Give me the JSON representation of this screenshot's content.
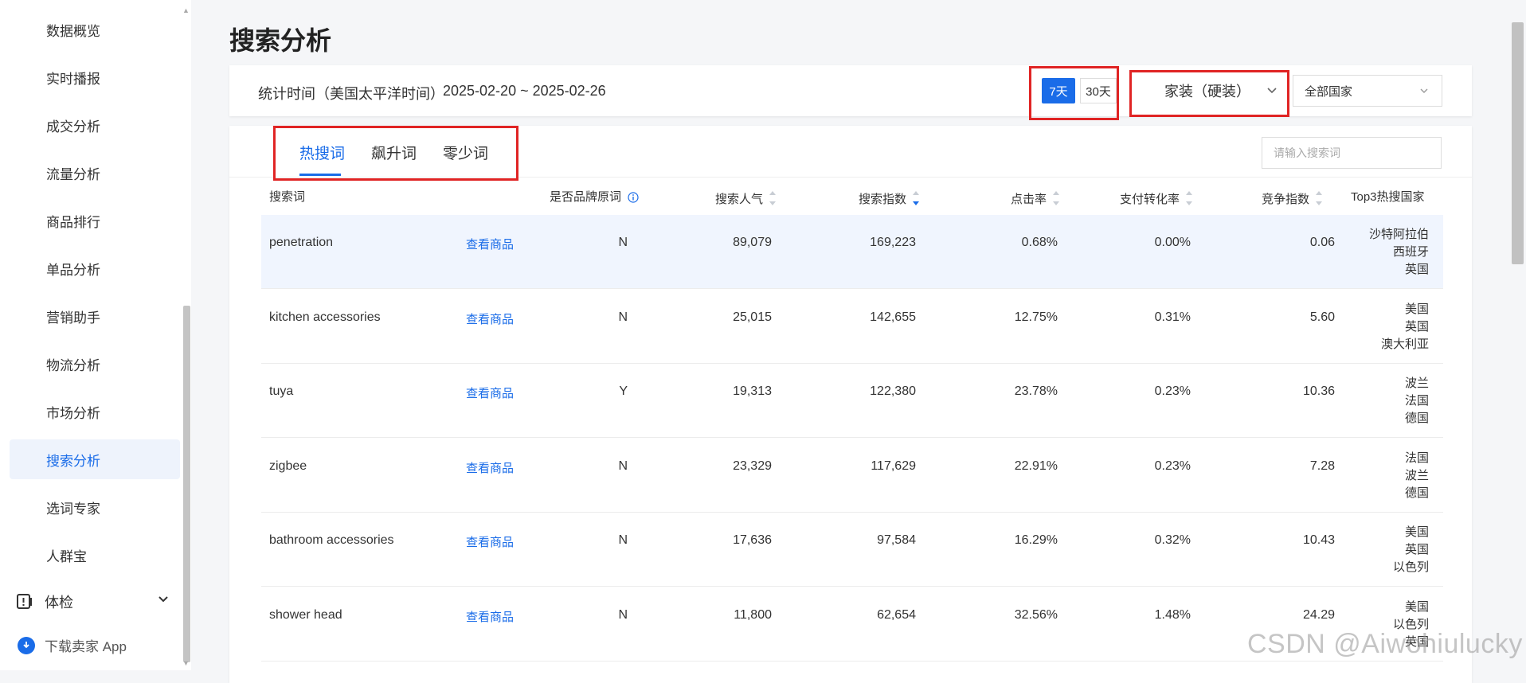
{
  "sidebar": {
    "items": [
      {
        "label": "数据概览",
        "active": false
      },
      {
        "label": "实时播报",
        "active": false
      },
      {
        "label": "成交分析",
        "active": false
      },
      {
        "label": "流量分析",
        "active": false
      },
      {
        "label": "商品排行",
        "active": false
      },
      {
        "label": "单品分析",
        "active": false
      },
      {
        "label": "营销助手",
        "active": false
      },
      {
        "label": "物流分析",
        "active": false
      },
      {
        "label": "市场分析",
        "active": false
      },
      {
        "label": "搜索分析",
        "active": true
      },
      {
        "label": "选词专家",
        "active": false
      },
      {
        "label": "人群宝",
        "active": false
      }
    ],
    "group": {
      "label": "体检",
      "icon": "health-check-icon"
    },
    "download": {
      "label": "下载卖家 App",
      "icon": "download-icon"
    }
  },
  "page": {
    "title": "搜索分析"
  },
  "filters": {
    "stat_label": "统计时间（美国太平洋时间）",
    "date_range": "2025-02-20 ~ 2025-02-26",
    "period_7": "7天",
    "period_30": "30天",
    "category": "家装（硬装）",
    "country": "全部国家"
  },
  "tabs": [
    {
      "label": "热搜词",
      "active": true
    },
    {
      "label": "飙升词",
      "active": false
    },
    {
      "label": "零少词",
      "active": false
    }
  ],
  "search": {
    "placeholder": "请输入搜索词"
  },
  "table": {
    "headers": {
      "keyword": "搜索词",
      "brand": "是否品牌原词",
      "popularity": "搜索人气",
      "index": "搜索指数",
      "ctr": "点击率",
      "conversion": "支付转化率",
      "competition": "竞争指数",
      "top3": "Top3热搜国家"
    },
    "link_label": "查看商品",
    "rows": [
      {
        "keyword": "penetration",
        "brand": "N",
        "popularity": "89,079",
        "index": "169,223",
        "ctr": "0.68%",
        "conversion": "0.00%",
        "competition": "0.06",
        "countries": [
          "沙特阿拉伯",
          "西班牙",
          "英国"
        ]
      },
      {
        "keyword": "kitchen accessories",
        "brand": "N",
        "popularity": "25,015",
        "index": "142,655",
        "ctr": "12.75%",
        "conversion": "0.31%",
        "competition": "5.60",
        "countries": [
          "美国",
          "英国",
          "澳大利亚"
        ]
      },
      {
        "keyword": "tuya",
        "brand": "Y",
        "popularity": "19,313",
        "index": "122,380",
        "ctr": "23.78%",
        "conversion": "0.23%",
        "competition": "10.36",
        "countries": [
          "波兰",
          "法国",
          "德国"
        ]
      },
      {
        "keyword": "zigbee",
        "brand": "N",
        "popularity": "23,329",
        "index": "117,629",
        "ctr": "22.91%",
        "conversion": "0.23%",
        "competition": "7.28",
        "countries": [
          "法国",
          "波兰",
          "德国"
        ]
      },
      {
        "keyword": "bathroom accessories",
        "brand": "N",
        "popularity": "17,636",
        "index": "97,584",
        "ctr": "16.29%",
        "conversion": "0.32%",
        "competition": "10.43",
        "countries": [
          "美国",
          "英国",
          "以色列"
        ]
      },
      {
        "keyword": "shower head",
        "brand": "N",
        "popularity": "11,800",
        "index": "62,654",
        "ctr": "32.56%",
        "conversion": "1.48%",
        "competition": "24.29",
        "countries": [
          "美国",
          "以色列",
          "英国"
        ]
      }
    ]
  },
  "watermark": "CSDN @Aiwohiulucky",
  "colors": {
    "accent": "#1a6ce8",
    "highlight": "#e02424",
    "row_highlight": "#f0f5fe"
  }
}
